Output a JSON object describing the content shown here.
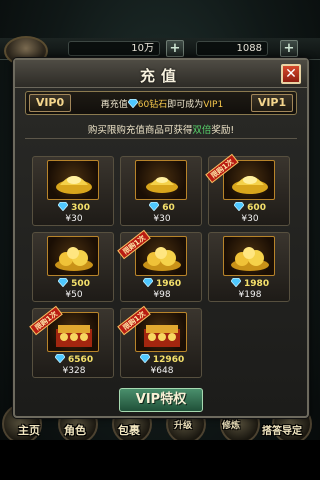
{
  "hud": {
    "gold": "10万",
    "diamonds": "1088",
    "plus": "+"
  },
  "nav": [
    {
      "label": "主页"
    },
    {
      "label": "角色"
    },
    {
      "label": "包裹"
    },
    {
      "label": "升级"
    },
    {
      "label": "修炼"
    },
    {
      "label": "搭答导定"
    }
  ],
  "dialog": {
    "title": "充值",
    "close": "✕",
    "vip_current": "VIP0",
    "vip_next": "VIP1",
    "need_prefix": "再充值",
    "need_amount": "60钻石",
    "need_mid": "即可成为",
    "need_target": "VIP1",
    "notice_prefix": "购买限购充值商品可获得",
    "notice_highlight": "双倍",
    "notice_suffix": "奖励!",
    "vip_button": "VIP特权"
  },
  "items": [
    {
      "diamonds": "300",
      "price": "¥30",
      "limited": false,
      "ribbon": ""
    },
    {
      "diamonds": "60",
      "price": "¥30",
      "limited": false,
      "ribbon": ""
    },
    {
      "diamonds": "600",
      "price": "¥30",
      "limited": true,
      "ribbon": "限购1次"
    },
    {
      "diamonds": "500",
      "price": "¥50",
      "limited": false,
      "ribbon": ""
    },
    {
      "diamonds": "1960",
      "price": "¥98",
      "limited": true,
      "ribbon": "限购1次"
    },
    {
      "diamonds": "1980",
      "price": "¥198",
      "limited": false,
      "ribbon": ""
    },
    {
      "diamonds": "6560",
      "price": "¥328",
      "limited": true,
      "ribbon": "限购1次"
    },
    {
      "diamonds": "12960",
      "price": "¥648",
      "limited": true,
      "ribbon": "限购1次"
    }
  ],
  "colors": {
    "diamond": "#4fc8ff",
    "gold": "#f6c84c",
    "double_highlight": "#58d36b",
    "close_button": "#c53a22"
  }
}
